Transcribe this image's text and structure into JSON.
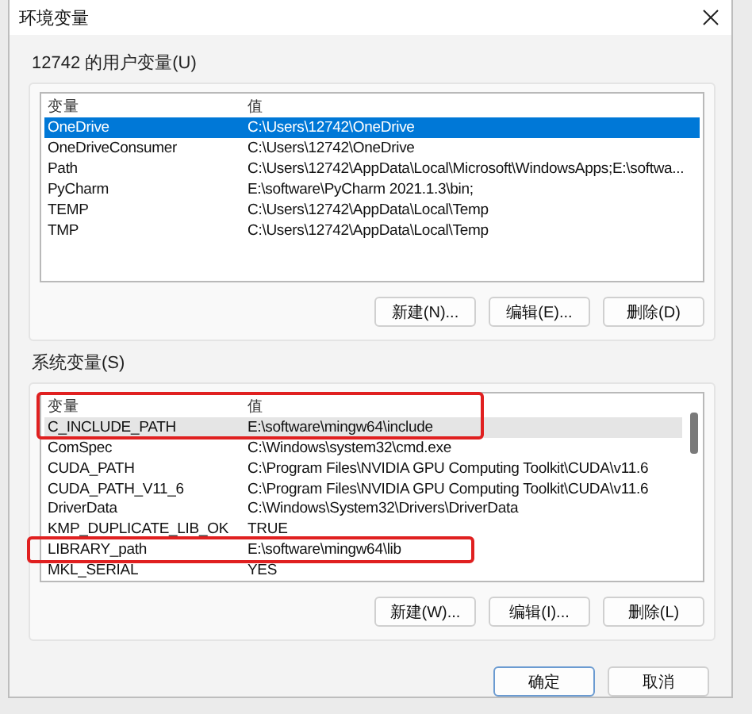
{
  "window": {
    "title": "环境变量"
  },
  "user_vars": {
    "label": "12742 的用户变量(U)",
    "columns": [
      "变量",
      "值"
    ],
    "header_boxed": false,
    "rows": [
      {
        "name": "OneDrive",
        "value": "C:\\Users\\12742\\OneDrive",
        "selected": true,
        "boxed": false
      },
      {
        "name": "OneDriveConsumer",
        "value": "C:\\Users\\12742\\OneDrive",
        "selected": false,
        "boxed": false
      },
      {
        "name": "Path",
        "value": "C:\\Users\\12742\\AppData\\Local\\Microsoft\\WindowsApps;E:\\softwa...",
        "selected": false,
        "boxed": false
      },
      {
        "name": "PyCharm",
        "value": "E:\\software\\PyCharm 2021.1.3\\bin;",
        "selected": false,
        "boxed": false
      },
      {
        "name": "TEMP",
        "value": "C:\\Users\\12742\\AppData\\Local\\Temp",
        "selected": false,
        "boxed": false
      },
      {
        "name": "TMP",
        "value": "C:\\Users\\12742\\AppData\\Local\\Temp",
        "selected": false,
        "boxed": false
      }
    ],
    "buttons": [
      "新建(N)...",
      "编辑(E)...",
      "删除(D)"
    ]
  },
  "system_vars": {
    "label": "系统变量(S)",
    "columns": [
      "变量",
      "值"
    ],
    "header_boxed": true,
    "rows": [
      {
        "name": "C_INCLUDE_PATH",
        "value": "E:\\software\\mingw64\\include",
        "selected": true,
        "boxed": true
      },
      {
        "name": "ComSpec",
        "value": "C:\\Windows\\system32\\cmd.exe",
        "selected": false,
        "boxed": false
      },
      {
        "name": "CUDA_PATH",
        "value": "C:\\Program Files\\NVIDIA GPU Computing Toolkit\\CUDA\\v11.6",
        "selected": false,
        "boxed": false
      },
      {
        "name": "CUDA_PATH_V11_6",
        "value": "C:\\Program Files\\NVIDIA GPU Computing Toolkit\\CUDA\\v11.6",
        "selected": false,
        "boxed": false
      },
      {
        "name": "DriverData",
        "value": "C:\\Windows\\System32\\Drivers\\DriverData",
        "selected": false,
        "boxed": false
      },
      {
        "name": "KMP_DUPLICATE_LIB_OK",
        "value": "TRUE",
        "selected": false,
        "boxed": false
      },
      {
        "name": "LIBRARY_path",
        "value": "E:\\software\\mingw64\\lib",
        "selected": false,
        "boxed": true
      },
      {
        "name": "MKL_SERIAL",
        "value": "YES",
        "selected": false,
        "boxed": false
      }
    ],
    "buttons": [
      "新建(W)...",
      "编辑(I)...",
      "删除(L)"
    ]
  },
  "footer_buttons": [
    {
      "label": "确定",
      "default": true
    },
    {
      "label": "取消",
      "default": false
    }
  ]
}
